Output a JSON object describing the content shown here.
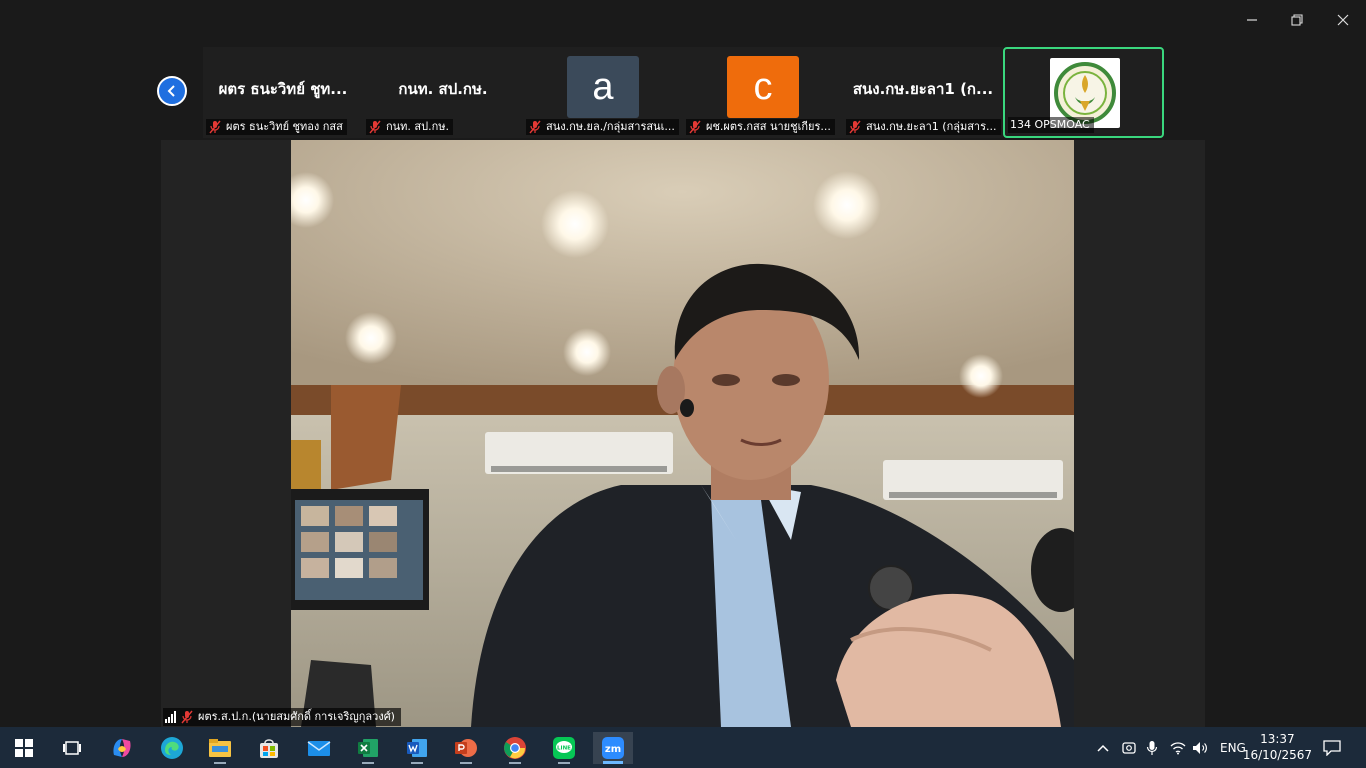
{
  "window": {
    "minimize_icon": "minimize-icon",
    "restore_icon": "restore-icon",
    "close_icon": "close-icon"
  },
  "strip": {
    "tiles": [
      {
        "name": "ผตร  ธนะวิทย์ ชูท...",
        "label": "ผตร  ธนะวิทย์ ชูทอง กสส"
      },
      {
        "name": "กนท. สป.กษ.",
        "label": "กนท. สป.กษ."
      },
      {
        "avatar_letter": "a",
        "avatar_color": "#3b4a5a",
        "label": "สนง.กษ.ยล./กลุ่มสารสนเ..."
      },
      {
        "avatar_letter": "c",
        "avatar_color": "#ef6c0c",
        "label": "ผช.ผตร.กสส นายชูเกียร..."
      },
      {
        "name": "สนง.กษ.ยะลา1 (ก...",
        "label": "สนง.กษ.ยะลา1 (กลุ่มสาร..."
      },
      {
        "label": "134 OPSMOAC",
        "active": true
      }
    ]
  },
  "main": {
    "speaker_label": "ผตร.ส.ป.ก.(นายสมศักดิ์ การเจริญกุลวงศ์)"
  },
  "taskbar": {
    "apps": [
      "start-icon",
      "task-view-icon",
      "copilot-icon",
      "edge-icon",
      "file-explorer-icon",
      "store-icon",
      "mail-icon",
      "excel-icon",
      "word-icon",
      "powerpoint-icon",
      "chrome-icon",
      "line-icon",
      "zoom-icon"
    ],
    "zoom_text": "zm",
    "language": "ENG",
    "time": "13:37",
    "date": "16/10/2567"
  },
  "colors": {
    "accent_blue": "#1f6fe0",
    "active_green": "#3ad77e",
    "mic_muted_red": "#e53935",
    "taskbar_bg": "#1c2a3a"
  }
}
